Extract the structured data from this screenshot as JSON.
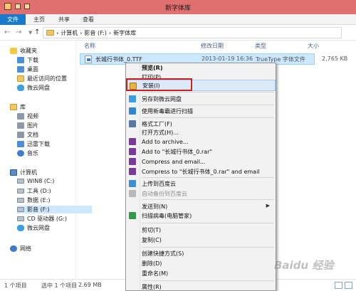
{
  "window": {
    "title": "新字体库"
  },
  "ribbon": {
    "tabs": [
      "文件",
      "主页",
      "共享",
      "查看"
    ]
  },
  "address": {
    "path": [
      "计算机",
      "影音 (F:)",
      "新字体库"
    ]
  },
  "sidebar": {
    "favorites": {
      "label": "收藏夹",
      "items": [
        "下载",
        "桌面",
        "最近访问的位置",
        "微云网盘"
      ]
    },
    "library": {
      "label": "库",
      "items": [
        "视频",
        "图片",
        "文档",
        "迅雷下载",
        "音乐"
      ]
    },
    "computer": {
      "label": "计算机",
      "items": [
        "WIN8 (C:)",
        "工具 (D:)",
        "数据 (E:)",
        "影音 (F:)",
        "CD 驱动器 (G:)",
        "微云网盘"
      ]
    },
    "network": {
      "label": "网络"
    }
  },
  "columns": {
    "name": "名称",
    "modified": "修改日期",
    "type": "类型",
    "size": "大小"
  },
  "file": {
    "name": "长城行书体_0.TTF",
    "modified": "2013-01-19 16:36",
    "type": "TrueType 字体文件",
    "size": "2,765 KB"
  },
  "context_menu": {
    "preview": "预览(R)",
    "print": "打印(P)",
    "install": "安装(I)",
    "save_to_cloud": "另存到微云网盘",
    "scan": "使用新毒霸进行扫描",
    "format_factory": "格式工厂(F)",
    "open_with": "打开方式(H)...",
    "add_archive": "Add to archive...",
    "add_rar": "Add to \"长城行书体_0.rar\"",
    "compress_email": "Compress and email...",
    "compress_rar_email": "Compress to \"长城行书体_0.rar\" and email",
    "upload_baidu": "上传到百度云",
    "auto_backup": "自动备份到百度云",
    "send_to": "发送到(N)",
    "virus_scan": "扫描病毒(电脑管家)",
    "cut": "剪切(T)",
    "copy": "复制(C)",
    "create_shortcut": "创建快捷方式(S)",
    "delete": "删除(D)",
    "rename": "重命名(M)",
    "properties": "属性(R)"
  },
  "status": {
    "count": "1 个项目",
    "selected": "选中 1 个项目",
    "size": "2.69 MB"
  },
  "watermark": "Baidu 经验",
  "colors": {
    "titlebar": "#e07070",
    "file_tab": "#1979ca",
    "selection": "#cce8ff",
    "install_box": "#cc1f1f"
  }
}
